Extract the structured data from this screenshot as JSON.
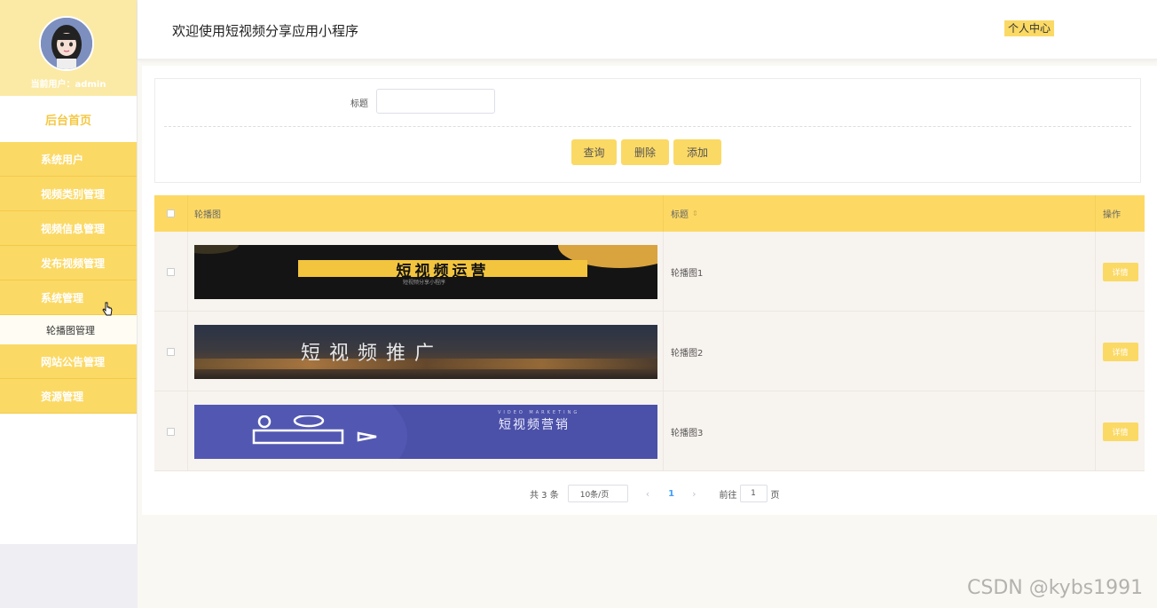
{
  "sidebar": {
    "user_label": "当前用户：admin",
    "home": "后台首页",
    "menu": [
      "系统用户",
      "视频类别管理",
      "视频信息管理",
      "发布视频管理",
      "系统管理"
    ],
    "submenu": "轮播图管理",
    "menu_after": [
      "网站公告管理",
      "资源管理"
    ]
  },
  "header": {
    "title": "欢迎使用短视频分享应用小程序",
    "profile": "个人中心"
  },
  "search": {
    "label": "标题",
    "value": "",
    "buttons": {
      "query": "查询",
      "delete": "删除",
      "add": "添加"
    }
  },
  "table": {
    "columns": {
      "image": "轮播图",
      "title": "标题",
      "title_sort_icon": "sort-icon",
      "actions": "操作"
    },
    "rows": [
      {
        "banner_text": "短视频运营",
        "banner_subtext": "短视频分享小程序",
        "title": "轮播图1",
        "action": "详情"
      },
      {
        "banner_text": "短视频推广",
        "title": "轮播图2",
        "action": "详情"
      },
      {
        "banner_text": "短视频营销",
        "banner_subtext": "VIDEO MARKETING",
        "title": "轮播图3",
        "action": "详情"
      }
    ]
  },
  "pagination": {
    "total": "共 3 条",
    "page_size": "10条/页",
    "prev_icon": "‹",
    "current": "1",
    "next_icon": "›",
    "goto_label": "前往",
    "goto_value": "1",
    "page_unit": "页"
  },
  "watermark": "CSDN @kybs1991",
  "colors": {
    "accent": "#fbd965",
    "row_bg": "#f7f3ee"
  }
}
